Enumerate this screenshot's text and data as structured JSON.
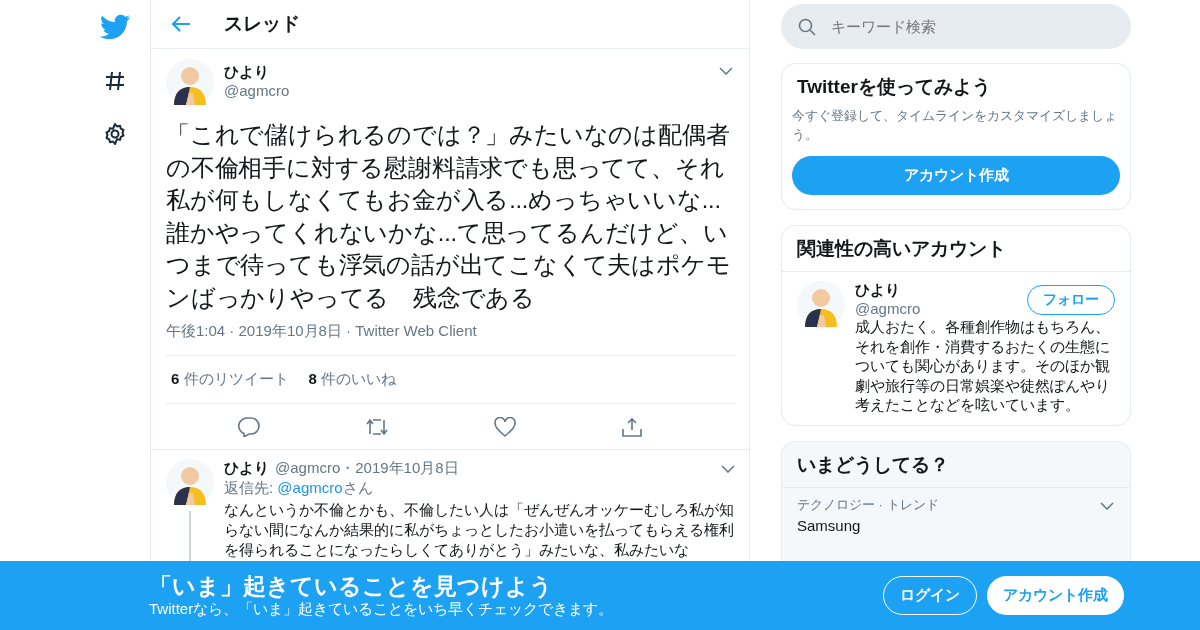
{
  "header": {
    "title": "スレッド"
  },
  "tweet": {
    "name": "ひより",
    "handle": "@agmcro",
    "text": "「これで儲けられるのでは？」みたいなのは配偶者の不倫相手に対する慰謝料請求でも思ってて、それ私が何もしなくてもお金が入る...めっちゃいいな...誰かやってくれないかな...て思ってるんだけど、いつまで待っても浮気の話が出てこなくて夫はポケモンばっかりやってる　残念である",
    "meta": "午後1:04 · 2019年10月8日 · Twitter Web Client",
    "stats": [
      {
        "count": "6",
        "label": "件のリツイート"
      },
      {
        "count": "8",
        "label": "件のいいね"
      }
    ]
  },
  "reply": {
    "name": "ひより",
    "meta": "@agmcro・2019年10月8日",
    "reply_to_label": "返信先: ",
    "reply_to_handle": "@agmcro",
    "reply_to_suffix": "さん",
    "text": "なんというか不倫とかも、不倫したい人は「ぜんぜんオッケーむしろ私が知らない間になんか結果的に私がちょっとしたお小遣いを払ってもらえる権利を得られることになったらしくてありがとう」みたいな、私みたいな"
  },
  "search": {
    "placeholder": "キーワード検索"
  },
  "signup_card": {
    "title": "Twitterを使ってみよう",
    "text": "今すぐ登録して、タイムラインをカスタマイズしましょう。",
    "button": "アカウント作成"
  },
  "related": {
    "title": "関連性の高いアカウント",
    "accounts": [
      {
        "name": "ひより",
        "handle": "@agmcro",
        "button": "フォロー",
        "bio": "成人おたく。各種創作物はもちろん、それを創作・消費するおたくの生態についても関心があります。そのほか観劇や旅行等の日常娯楽や徒然ぽんやり考えたことなどを呟いています。"
      }
    ]
  },
  "trends": {
    "title": "いまどうしてる？",
    "items": [
      {
        "category": "テクノロジー · トレンド",
        "name": "Samsung"
      }
    ]
  },
  "banner": {
    "title": "「いま」起きていることを見つけよう",
    "subtitle": "Twitterなら、「いま」起きていることをいち早くチェックできます。",
    "login": "ログイン",
    "signup": "アカウント作成"
  }
}
